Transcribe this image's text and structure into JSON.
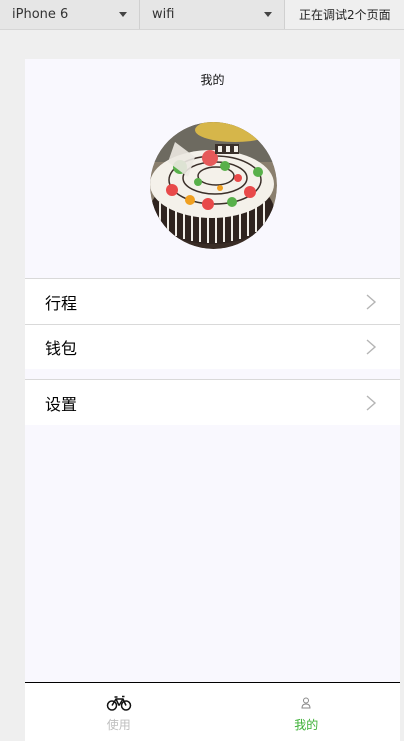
{
  "toolbar": {
    "device": "iPhone 6",
    "network": "wifi",
    "status": "正在调试2个页面"
  },
  "header": {
    "title": "我的"
  },
  "menu": {
    "items": [
      {
        "label": "行程"
      },
      {
        "label": "钱包"
      },
      {
        "label": "设置"
      }
    ]
  },
  "tabbar": {
    "tabs": [
      {
        "label": "使用",
        "icon": "bicycle-icon",
        "active": false
      },
      {
        "label": "我的",
        "icon": "user-icon",
        "active": true
      }
    ]
  },
  "colors": {
    "active_tab": "#3cb035",
    "inactive_tab": "#bfbfbf",
    "page_bg": "#f9f8fe"
  }
}
